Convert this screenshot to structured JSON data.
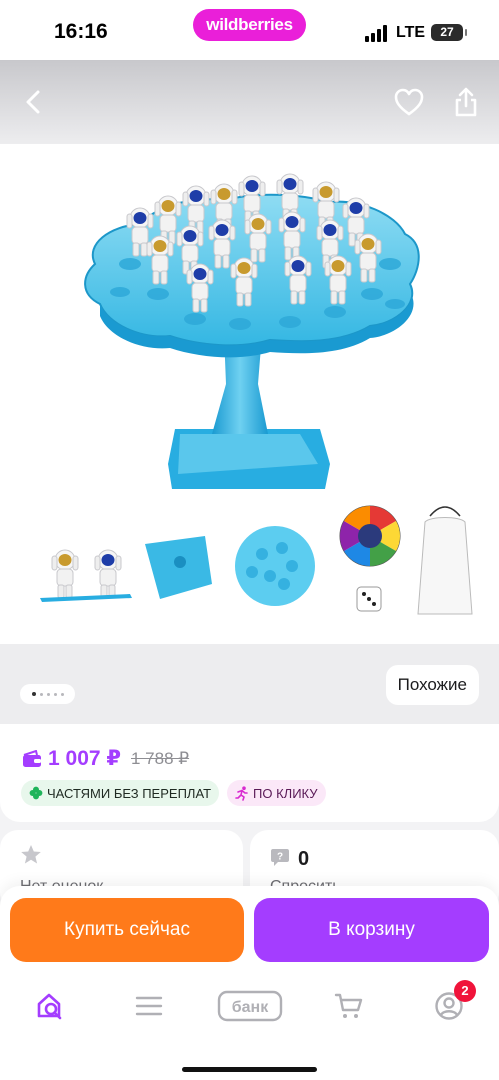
{
  "status_bar": {
    "time": "16:16",
    "brand": "wildberries",
    "network": "LTE",
    "battery": "27"
  },
  "gallery": {
    "back_icon": "chevron-left-icon",
    "favorite_icon": "heart-icon",
    "share_icon": "share-icon",
    "image_count": 5,
    "active_image": 1,
    "similar_label": "Похожие"
  },
  "price": {
    "current": "1 007 ₽",
    "old": "1 788 ₽",
    "wallet_icon": "wallet-icon",
    "badges": [
      {
        "icon": "clover-icon",
        "label": "ЧАСТЯМИ БЕЗ ПЕРЕПЛАТ",
        "color": "#1fb45a"
      },
      {
        "icon": "running-person-icon",
        "label": "ПО КЛИКУ",
        "color": "#d82bd0"
      }
    ]
  },
  "info": {
    "rating_label": "Нет оценок",
    "questions_count": "0",
    "questions_label": "Спросить"
  },
  "actions": {
    "buy_now": "Купить сейчас",
    "add_to_cart": "В корзину"
  },
  "tabbar": {
    "items": [
      {
        "name": "home",
        "icon": "home-search-icon"
      },
      {
        "name": "catalog",
        "icon": "menu-icon"
      },
      {
        "name": "bank",
        "label": "банк"
      },
      {
        "name": "cart",
        "icon": "cart-icon"
      },
      {
        "name": "profile",
        "icon": "profile-icon",
        "badge": "2"
      }
    ]
  },
  "colors": {
    "accent": "#a43dff",
    "buy": "#ff7a1a",
    "brand_pill": "#ea1fd9",
    "badge_red": "#f0133a"
  }
}
